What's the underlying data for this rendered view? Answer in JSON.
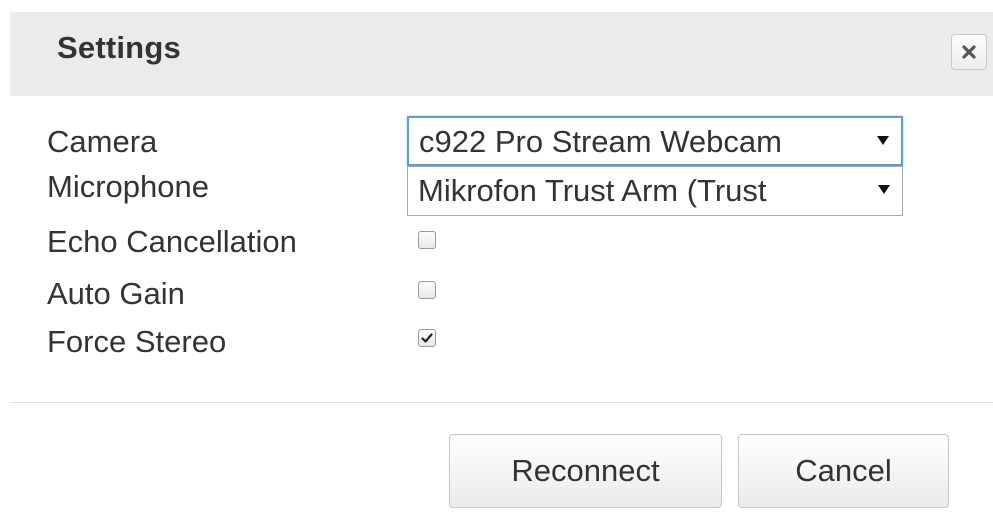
{
  "dialog": {
    "title": "Settings",
    "close_icon": "close-icon"
  },
  "form": {
    "camera": {
      "label": "Camera",
      "value": "c922 Pro Stream Webcam"
    },
    "microphone": {
      "label": "Microphone",
      "value": "Mikrofon Trust Arm (Trust"
    },
    "echo_cancellation": {
      "label": "Echo Cancellation",
      "checked": false
    },
    "auto_gain": {
      "label": "Auto Gain",
      "checked": false
    },
    "force_stereo": {
      "label": "Force Stereo",
      "checked": true
    }
  },
  "buttons": {
    "reconnect": "Reconnect",
    "cancel": "Cancel"
  },
  "colors": {
    "titlebar_bg": "#ebebeb",
    "text": "#333333",
    "focus_border": "#5b9dd9"
  }
}
